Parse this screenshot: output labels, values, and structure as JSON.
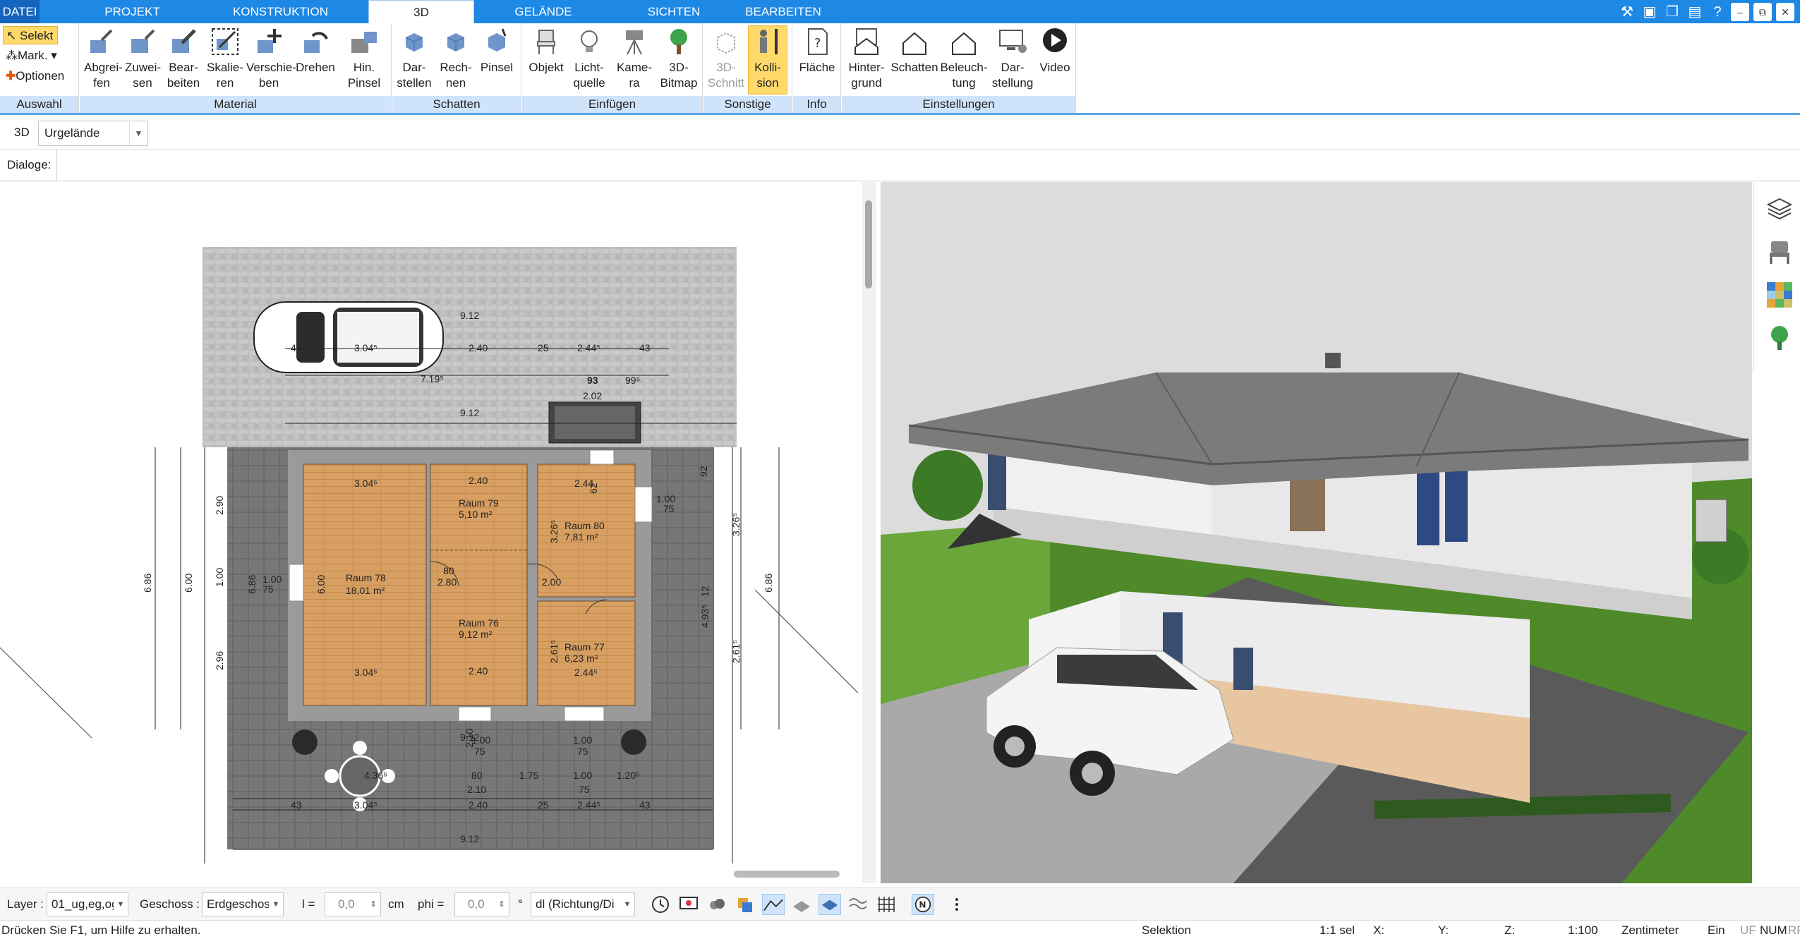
{
  "menu": {
    "tabs": [
      {
        "label": "DATEI"
      },
      {
        "label": "PROJEKT"
      },
      {
        "label": "KONSTRUKTION"
      },
      {
        "label": "3D"
      },
      {
        "label": "GELÄNDE"
      },
      {
        "label": "SICHTEN"
      },
      {
        "label": "BEARBEITEN"
      }
    ],
    "active_tab": "3D"
  },
  "ribbon": {
    "auswahl": {
      "label": "Auswahl",
      "selekt": "Selekt",
      "mark": "Mark.",
      "optionen": "Optionen"
    },
    "material": {
      "label": "Material",
      "buttons": [
        {
          "line1": "Abgrei-",
          "line2": "fen"
        },
        {
          "line1": "Zuwei-",
          "line2": "sen"
        },
        {
          "line1": "Bear-",
          "line2": "beiten"
        },
        {
          "line1": "Skalie-",
          "line2": "ren"
        },
        {
          "line1": "Verschie-",
          "line2": "ben"
        },
        {
          "line1": "Drehen",
          "line2": ""
        },
        {
          "line1": "Hin.",
          "line2": "Pinsel"
        }
      ]
    },
    "schatten": {
      "label": "Schatten",
      "buttons": [
        {
          "line1": "Dar-",
          "line2": "stellen"
        },
        {
          "line1": "Rech-",
          "line2": "nen"
        },
        {
          "line1": "Pinsel",
          "line2": ""
        }
      ]
    },
    "einfuegen": {
      "label": "Einfügen",
      "buttons": [
        {
          "line1": "Objekt",
          "line2": ""
        },
        {
          "line1": "Licht-",
          "line2": "quelle"
        },
        {
          "line1": "Kame-",
          "line2": "ra"
        },
        {
          "line1": "3D-",
          "line2": "Bitmap"
        }
      ]
    },
    "sonstige": {
      "label": "Sonstige",
      "buttons": [
        {
          "line1": "3D-",
          "line2": "Schnitt"
        },
        {
          "line1": "Kolli-",
          "line2": "sion"
        }
      ]
    },
    "info": {
      "label": "Info",
      "buttons": [
        {
          "line1": "Fläche",
          "line2": ""
        }
      ]
    },
    "einstellungen": {
      "label": "Einstellungen",
      "buttons": [
        {
          "line1": "Hinter-",
          "line2": "grund"
        },
        {
          "line1": "Schatten",
          "line2": ""
        },
        {
          "line1": "Beleuch-",
          "line2": "tung"
        },
        {
          "line1": "Dar-",
          "line2": "stellung"
        },
        {
          "line1": "Video",
          "line2": ""
        }
      ]
    }
  },
  "toolbar": {
    "view_label": "3D",
    "view_combo": "Urgelände",
    "dialoge_label": "Dialoge:"
  },
  "plan": {
    "dims": {
      "d912a": "9.12",
      "d240a": "2.40",
      "d25a": "25",
      "d2445a": "2.44⁵",
      "d43a": "43",
      "d43b": "43",
      "d3045car": "3.04⁵",
      "d7195": "7.19⁵",
      "d93": "93",
      "d995": "99⁵",
      "d202": "2.02",
      "d912b": "9.12",
      "r1": "Raum 78",
      "r1a": "18,01 m²",
      "r2": "Raum 79",
      "r2a": "5,10 m²",
      "r3": "Raum 80",
      "r3a": "7,81 m²",
      "r4": "Raum 76",
      "r4a": "9,12 m²",
      "r5": "Raum 77",
      "r5a": "6,23 m²",
      "t3045": "3.04⁵",
      "t240": "2.40",
      "t244": "2.44",
      "b3045": "3.04⁵",
      "b240": "2.40",
      "b2445": "2.44⁵",
      "l686": "6.86",
      "l600": "6.00",
      "l290": "2.90",
      "l296": "2.96",
      "l100": "1.00",
      "rt686": "6.86",
      "rt326": "3.26⁵",
      "rt261": "2.61⁵",
      "rt493": "4.93⁵",
      "i600": "6.00",
      "i686": "6.86",
      "i100": "1.00",
      "i75": "75",
      "i80": "80",
      "i280": "2.80",
      "i200": "2.00",
      "i62": "62",
      "i326": "3.26⁵",
      "i261": "2.61⁵",
      "i100b": "1.00",
      "i75b": "75",
      "i92": "92",
      "i12": "12",
      "bt912": "9.12",
      "bt210": "2.10",
      "bt80": "80",
      "bt175": "1.75",
      "bt100": "1.00",
      "bt120": "1.20⁵",
      "bt210b": "2.10",
      "bt75": "75",
      "bt436": "4.36⁵",
      "bt3045": "3.04⁵",
      "bt240": "2.40",
      "bt25": "25",
      "bt2445": "2.44⁵",
      "bt43": "43",
      "bt43b": "43",
      "bt912b": "9.12",
      "c100": "1.00",
      "c75": "75",
      "c100b": "1.00",
      "c75b": "75"
    }
  },
  "bottom": {
    "layer_label": "Layer :",
    "layer_value": "01_ug,eg,og",
    "geschoss_label": "Geschoss :",
    "geschoss_value": "Erdgeschoss",
    "l_label": "l =",
    "l_value": "0,0",
    "l_unit": "cm",
    "phi_label": "phi =",
    "phi_value": "0,0",
    "phi_unit": "°",
    "dl_value": "dl (Richtung/Di"
  },
  "status": {
    "help": "Drücken Sie F1, um Hilfe zu erhalten.",
    "mode": "Selektion",
    "scale_sel": "1:1 sel",
    "x": "X:",
    "y": "Y:",
    "z": "Z:",
    "scale": "1:100",
    "unit": "Zentimeter",
    "ein": "Ein",
    "uf": "UF",
    "num": "NUM",
    "rf": "RF"
  },
  "colors": {
    "accent": "#1e88e5",
    "ribbon_group_bg": "#cfe3fb",
    "active_btn": "#ffd96a",
    "floor_wood": "#d9a46a",
    "paving": "#bdbdbd",
    "dark_paving": "#6f6f6f",
    "grass": "#5c9a32"
  }
}
